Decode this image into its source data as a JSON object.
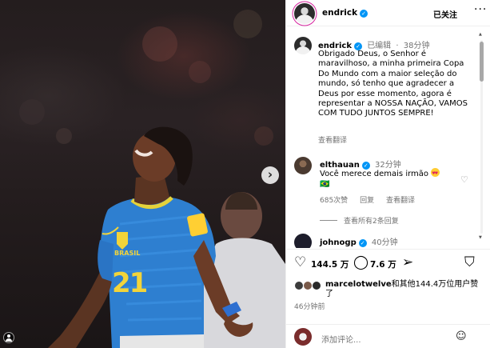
{
  "post": {
    "username": "endrick",
    "follow_label": "已关注",
    "more_label": "···"
  },
  "caption": {
    "username": "endrick",
    "edited": "已编辑",
    "separator": "·",
    "time": "38分钟",
    "text": "Obrigado Deus, o Senhor é maravilhoso, a minha primeira Copa Do Mundo com a maior seleção do mundo, só tenho que agradecer a Deus por esse momento, agora é representar a NOSSA NAÇÃO, VAMOS COM TUDO JUNTOS SEMPRE!",
    "translate": "查看翻译"
  },
  "comments": [
    {
      "username": "elthauan",
      "time": "32分钟",
      "text": "Você merece demais irmão",
      "second_line": "🇧🇷",
      "likes": "685次赞",
      "reply": "回复",
      "translate": "查看翻译",
      "view_replies": "查看所有2条回复"
    },
    {
      "username": "johnogp",
      "time": "40分钟"
    }
  ],
  "actions": {
    "likes_count": "144.5 万",
    "comments_count": "7.6 万"
  },
  "liked_by": {
    "username": "marcelotwelve",
    "rest": "和其他144.4万位用户赞了"
  },
  "time_ago": "46分钟前",
  "add_comment": {
    "placeholder": "添加评论..."
  },
  "photo": {
    "jersey_number": "21",
    "badge_text": "BRASIL"
  },
  "colors": {
    "verified": "#0095f6",
    "jersey": "#2e7fd0",
    "link_muted": "#737373"
  }
}
